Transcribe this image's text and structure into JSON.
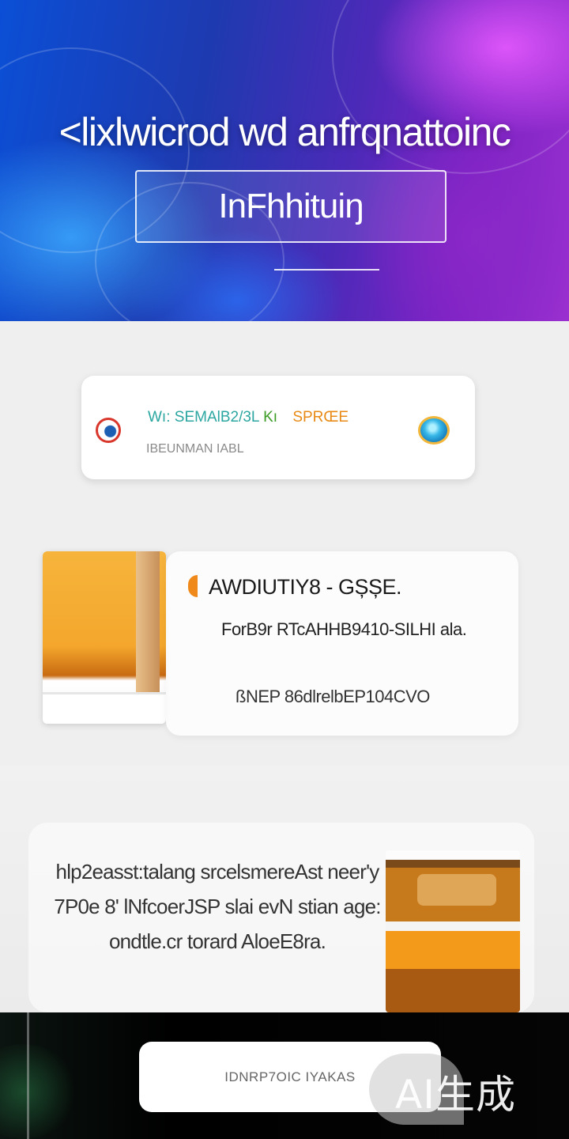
{
  "hero": {
    "title": "<lixlwicrod wd anfrqnattoinc",
    "cta_label": "InFhhituiŋ"
  },
  "info_card": {
    "line1_prefix": "Wı: SEMAlB2/3L",
    "line1_green": "Kı",
    "line1_orange": "SPRŒE",
    "line2": "IBEUNMAN IABL",
    "left_icon": "brand-logo-icon",
    "right_icon": "globe-icon"
  },
  "feature": {
    "title": "AWDIUTIY8 - GȘȘE.",
    "subtitle": "ForB9r RTcAHHB9410-SILHI ala.",
    "meta": "ßNEP 86dlrelbEP104CVO",
    "image": "orange-shelf-photo"
  },
  "description": {
    "text": "hlp2easst:talang srcelsmereAst neer'y 7P0e 8' lNfcoerJSP slai evN stian age: ondtle.cr torard AloeE8ra.",
    "image": "orange-goggles-photo"
  },
  "footer": {
    "button_label": "IDNRP7OIC IYAKAS"
  },
  "watermark": {
    "text": "AI生成"
  },
  "colors": {
    "hero_blue": "#0b4fd6",
    "hero_purple": "#9b30d0",
    "accent_orange": "#ef8a1a",
    "background": "#efefef"
  }
}
